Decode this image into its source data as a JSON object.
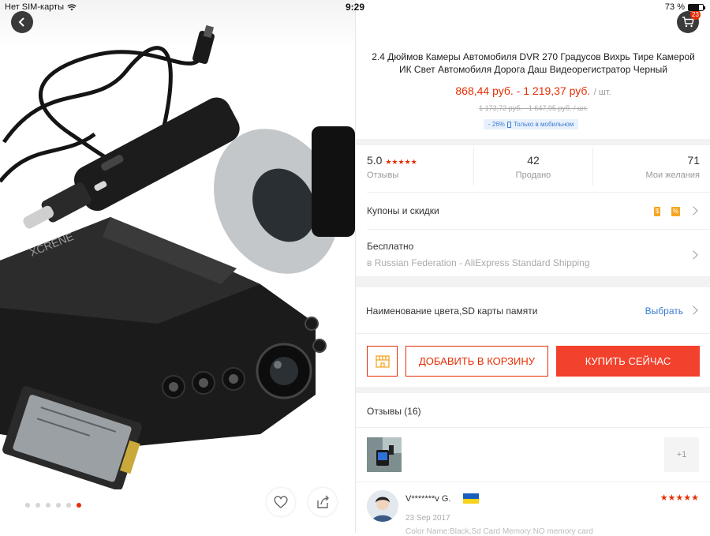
{
  "status_bar": {
    "carrier": "Нет SIM-карты",
    "time": "9:29",
    "battery_percent": "73 %",
    "battery_level": 0.73
  },
  "gallery": {
    "image_count": 6,
    "active_index": 5,
    "icons": {
      "back": "back-arrow-icon",
      "favorite": "heart-icon",
      "share": "share-icon"
    }
  },
  "header": {
    "cart_badge": "23",
    "cart_icon": "cart-icon"
  },
  "product": {
    "title": "2.4 Дюймов Камеры Автомобиля DVR 270 Градусов Вихрь Тире Камерой ИК Свет Автомобиля Дорога Даш Видеорегистратор Черный",
    "price": "868,44 руб. - 1 219,37 руб.",
    "price_unit": "/ шт.",
    "old_price": "1 173,72 руб. - 1 647,95 руб. / шт.",
    "mobile_discount": "- 26%",
    "mobile_only": "Только в мобильном"
  },
  "stats": {
    "rating": "5.0",
    "rating_label": "Отзывы",
    "sold": "42",
    "sold_label": "Продано",
    "wishlist": "71",
    "wishlist_label": "Мои желания"
  },
  "coupons": {
    "label": "Купоны и скидки",
    "tag_dollar": "$",
    "tag_percent": "%"
  },
  "shipping": {
    "label": "Бесплатно",
    "detail": "в Russian Federation - AliExpress Standard Shipping"
  },
  "options": {
    "label": "Наименование цвета,SD карты памяти",
    "select": "Выбрать"
  },
  "actions": {
    "add_to_cart": "ДОБАВИТЬ В КОРЗИНУ",
    "buy_now": "КУПИТЬ СЕЙЧАС"
  },
  "reviews": {
    "header": "Отзывы (16)",
    "more_photos": "+1",
    "items": [
      {
        "name": "V*******v G.",
        "stars": "★★★★★",
        "date": "23 Sep 2017",
        "meta": "Color Name:Black,Sd Card Memory:NO memory card"
      }
    ]
  },
  "colors": {
    "accent": "#e62e04",
    "link": "#3a7bd5"
  }
}
